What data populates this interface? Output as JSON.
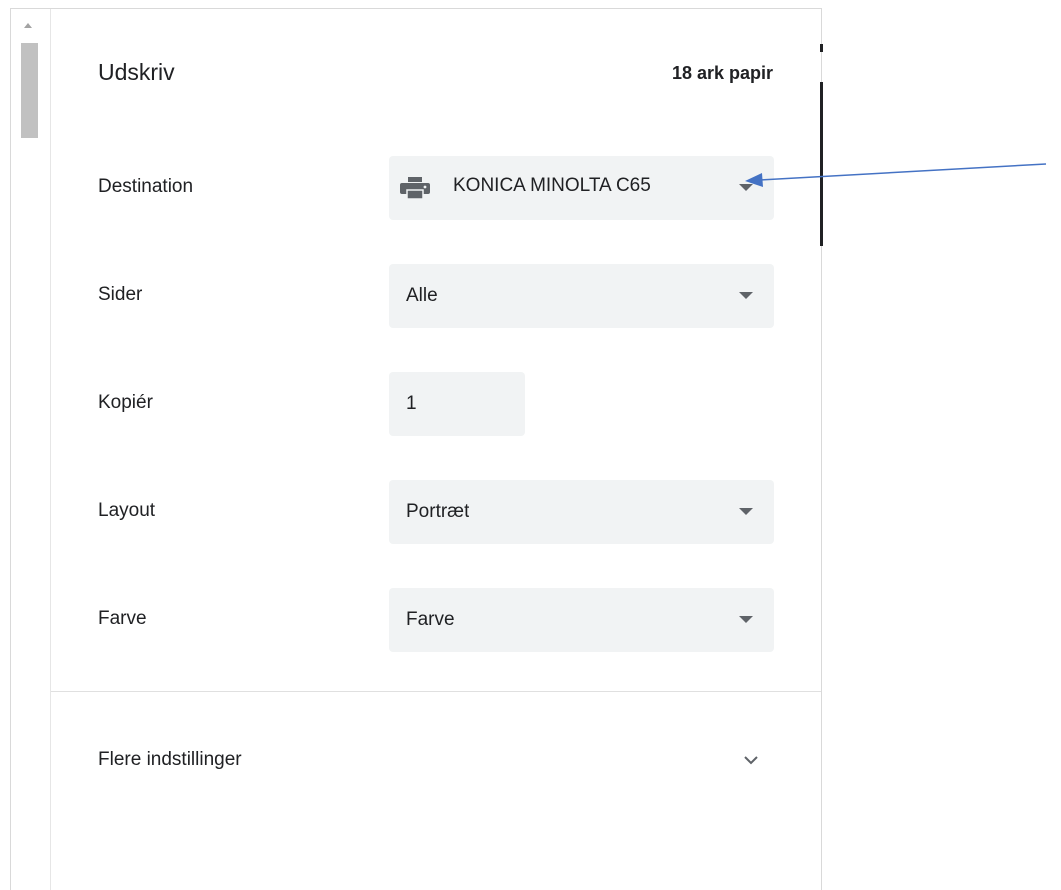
{
  "dialog": {
    "title": "Udskriv",
    "sheet_count": "18 ark papir"
  },
  "destination": {
    "label": "Destination",
    "value": "KONICA MINOLTA C65",
    "icon": "printer-icon"
  },
  "pages": {
    "label": "Sider",
    "value": "Alle"
  },
  "copies": {
    "label": "Kopiér",
    "value": "1"
  },
  "layout": {
    "label": "Layout",
    "value": "Portræt"
  },
  "color": {
    "label": "Farve",
    "value": "Farve"
  },
  "more_settings": {
    "label": "Flere indstillinger",
    "icon": "chevron-down-icon"
  },
  "colors": {
    "field_bg": "#f1f3f4",
    "text": "#202124",
    "icon": "#5f6368",
    "annotation_arrow": "#4472c4"
  }
}
